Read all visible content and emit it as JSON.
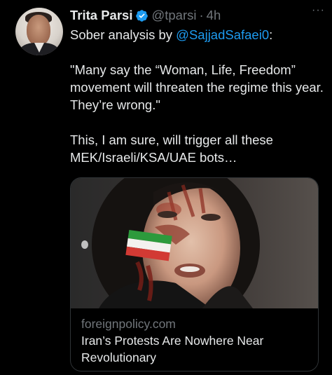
{
  "author": {
    "name": "Trita Parsi",
    "handle": "@tparsi",
    "separator": "·",
    "time": "4h",
    "verified": true,
    "avatar_icon": "profile-photo"
  },
  "more_label": "···",
  "tweet": {
    "intro_prefix": "Sober analysis by ",
    "mention": "@SajjadSafaei0",
    "intro_suffix": ":",
    "quote": "\"Many say the “Woman, Life, Freedom” movement will threaten the regime this year. They’re wrong.\"",
    "comment": "This, I am sure, will trigger all these MEK/Israeli/KSA/UAE bots…"
  },
  "link_card": {
    "domain": "foreignpolicy.com",
    "title": "Iran’s Protests Are Nowhere Near Revolutionary",
    "image_icon": "protester-photo"
  },
  "colors": {
    "background": "#000000",
    "text": "#e7e9ea",
    "muted": "#71767b",
    "link": "#1d9bf0",
    "border": "#2f3336",
    "verified_badge": "#1d9bf0"
  }
}
